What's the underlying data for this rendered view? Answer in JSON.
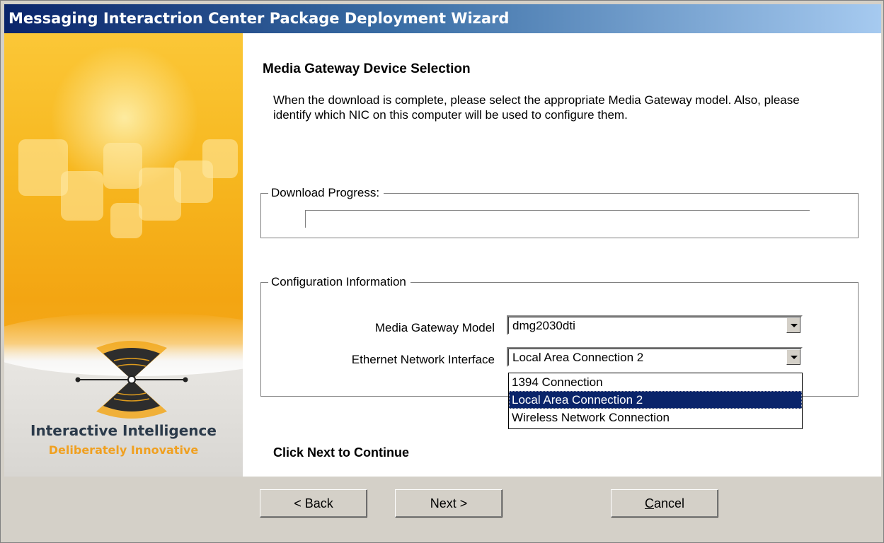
{
  "window": {
    "title": "Messaging Interactrion Center Package Deployment Wizard"
  },
  "side": {
    "brand": "Interactive Intelligence",
    "tagline": "Deliberately Innovative"
  },
  "page": {
    "heading": "Media Gateway Device Selection",
    "description": "When the download is complete, please select the appropriate Media Gateway model.  Also, please identify which NIC on this computer will be used to configure them.",
    "hint": "Click Next to Continue"
  },
  "download": {
    "legend": "Download Progress:",
    "progress_percent": 0
  },
  "config": {
    "legend": "Configuration Information",
    "model_label": "Media Gateway Model",
    "model_value": "dmg2030dti",
    "nic_label": "Ethernet Network Interface",
    "nic_value": "Local Area Connection 2",
    "nic_options": [
      "1394 Connection",
      "Local Area Connection 2",
      "Wireless Network Connection"
    ],
    "nic_selected_index": 1
  },
  "buttons": {
    "back": "< Back",
    "next": "Next >",
    "cancel_prefix": "",
    "cancel_mnemonic": "C",
    "cancel_rest": "ancel"
  },
  "colors": {
    "title_start": "#0a246a",
    "title_end": "#a6caf0",
    "highlight": "#0a246a",
    "panel_orange": "#f7b820"
  },
  "icons": [
    "combo-arrow-icon",
    "interactive-intelligence-logo-icon"
  ]
}
